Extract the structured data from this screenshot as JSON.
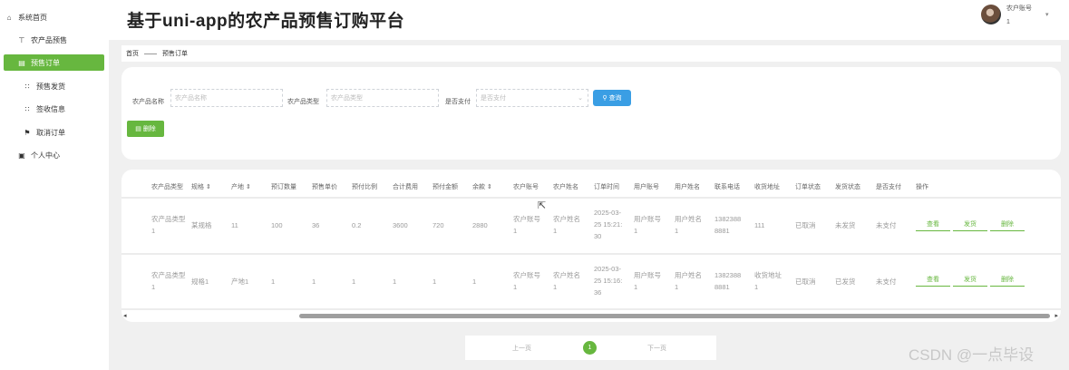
{
  "app": {
    "title": "基于uni-app的农产品预售订购平台"
  },
  "user": {
    "label": "农户账号",
    "sub": "1",
    "caret": "▾"
  },
  "sidebar": {
    "items": [
      {
        "icon": "⌂",
        "label": "系统首页"
      },
      {
        "icon": "⊤",
        "label": "农产品预售"
      },
      {
        "icon": "▤",
        "label": "预售订单"
      },
      {
        "icon": "∷",
        "label": "预售发货"
      },
      {
        "icon": "∷",
        "label": "签收信息"
      },
      {
        "icon": "⚑",
        "label": "取消订单"
      },
      {
        "icon": "▣",
        "label": "个人中心"
      }
    ],
    "active_index": 2
  },
  "breadcrumb": {
    "home": "首页",
    "sep": "——",
    "current": "预售订单"
  },
  "filter": {
    "name_label": "农产品名称",
    "name_placeholder": "农产品名称",
    "type_label": "农产品类型",
    "type_placeholder": "农产品类型",
    "paid_label": "是否支付",
    "paid_placeholder": "是否支付",
    "search_label": "查询",
    "delete_label": "删除"
  },
  "table": {
    "columns": [
      "农产品类型",
      "规格 ⇕",
      "产地 ⇕",
      "预订数量",
      "预售单价",
      "预付比例",
      "合计费用",
      "预付金额",
      "余款 ⇕",
      "农户账号",
      "农户姓名",
      "订单时间",
      "用户账号",
      "用户姓名",
      "联系电话",
      "收货地址",
      "订单状态",
      "发货状态",
      "是否支付",
      "操作"
    ],
    "rows": [
      {
        "type": "农产品类型1",
        "spec": "某规格",
        "origin": "11",
        "qty": "100",
        "price": "36",
        "ratio": "0.2",
        "total": "3600",
        "prepay": "720",
        "balance": "2880",
        "farmer_acct": "农户账号1",
        "farmer_name": "农户姓名1",
        "time": "2025-03-25 15:21:30",
        "user_acct": "用户账号1",
        "user_name": "用户姓名1",
        "phone": "13823888881",
        "address": "111",
        "order_status": "已取消",
        "ship_status": "未发货",
        "paid": "未支付"
      },
      {
        "type": "农产品类型1",
        "spec": "规格1",
        "origin": "产地1",
        "qty": "1",
        "price": "1",
        "ratio": "1",
        "total": "1",
        "prepay": "1",
        "balance": "1",
        "farmer_acct": "农户账号1",
        "farmer_name": "农户姓名1",
        "time": "2025-03-25 15:16:36",
        "user_acct": "用户账号1",
        "user_name": "用户姓名1",
        "phone": "13823888881",
        "address": "收货地址1",
        "order_status": "已取消",
        "ship_status": "已发货",
        "paid": "未支付"
      }
    ],
    "actions": {
      "view": "查看",
      "ship": "发货",
      "delete": "删除"
    }
  },
  "scrollbar": {
    "left": "◂",
    "right": "▸"
  },
  "pagination": {
    "prev": "上一页",
    "current": "1",
    "next": "下一页"
  },
  "watermark": "CSDN @一点毕设",
  "cursor": "⇱"
}
